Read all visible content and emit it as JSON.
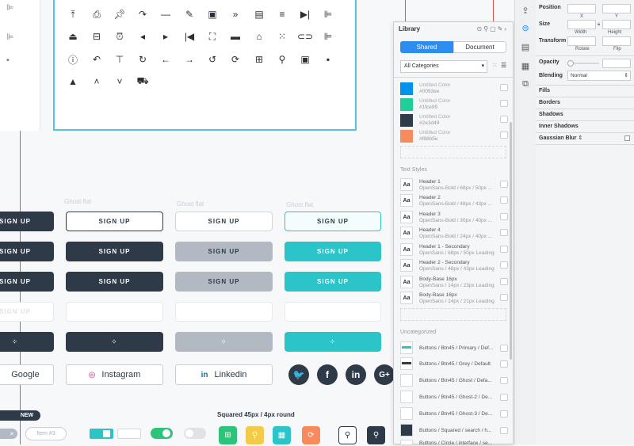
{
  "ghost_label": "Ghost flat",
  "buttons": {
    "sign_up": "SIGN UP"
  },
  "social": {
    "google": "Google",
    "instagram": "Instagram",
    "linkedin": "Linkedin",
    "twitter_icon": "twitter-icon",
    "facebook_icon": "facebook-icon",
    "linkedin_icon": "linkedin-icon",
    "gplus_icon": "google-plus-icon",
    "twitter_glyph": "🐦",
    "facebook_glyph": "f",
    "linkedin_glyph": "in",
    "gplus_glyph": "G+"
  },
  "bottom": {
    "new_badge": "NEW",
    "item_input": "Item #3",
    "squared_title": "Squared 45px / 4px round"
  },
  "library": {
    "title": "Library",
    "tab_shared": "Shared",
    "tab_document": "Document",
    "category": "All Categories",
    "colors": [
      {
        "name": "Untitled Color",
        "hex": "#0093ee"
      },
      {
        "name": "Untitled Color",
        "hex": "#1fce99"
      },
      {
        "name": "Untitled Color",
        "hex": "#2e3d49"
      },
      {
        "name": "Untitled Color",
        "hex": "#f88b5e"
      }
    ],
    "text_styles_label": "Text Styles",
    "text_styles": [
      {
        "name": "Header 1",
        "desc": "OpenSans-Bold / 68px / 50px ..."
      },
      {
        "name": "Header 2",
        "desc": "OpenSans-Bold / 48px / 43px ..."
      },
      {
        "name": "Header 3",
        "desc": "OpenSans-Bold / 30px / 40px ..."
      },
      {
        "name": "Header 4",
        "desc": "OpenSans-Bold / 24px / 40px ..."
      },
      {
        "name": "Header 1 - Secondary",
        "desc": "OpenSans / 68px / 50px Leading"
      },
      {
        "name": "Header 2 - Secondary",
        "desc": "OpenSans / 48px / 43px Leading"
      },
      {
        "name": "Body-Base 16px",
        "desc": "OpenSans / 14px / 23px Leading"
      },
      {
        "name": "Body-Base 16px",
        "desc": "OpenSans / 14px / 21px Leading"
      }
    ],
    "aa": "Aa",
    "uncategorized_label": "Uncategorized",
    "symbols": [
      "Buttons / Btn45 / Primary / Def...",
      "Buttons / Btn45 / Grey / Default",
      "Buttons / Btn45 / Ghost / Defa...",
      "Buttons / Btn45 / Ghost-2 / De...",
      "Buttons / Btn45 / Ghost-3 / De...",
      "Buttons / Squared / search / h...",
      "Buttons / Circle / interface / se..."
    ]
  },
  "inspector": {
    "position": "Position",
    "x": "X",
    "y": "Y",
    "size": "Size",
    "width": "Width",
    "height": "Height",
    "transform": "Transform",
    "rotate": "Rotate",
    "flip": "Flip",
    "opacity": "Opacity",
    "blending": "Blending",
    "blending_value": "Normal",
    "fills": "Fills",
    "borders": "Borders",
    "shadows": "Shadows",
    "inner_shadows": "Inner Shadows",
    "gaussian_blur": "Gaussian Blur"
  },
  "colors": {
    "dark": "#2e3a47",
    "teal": "#2bc4c9",
    "grey": "#b3b9c2",
    "accent_blue": "#56c3e0",
    "guide_red": "#e8544d"
  },
  "icons": {
    "grid_row1": [
      "upload-icon",
      "print-icon",
      "pin-icon",
      "redo-icon",
      "minus-icon",
      "pencil-icon",
      "save-doc-icon",
      "double-chevron-right-icon",
      "sd-card-icon",
      "filter-icon",
      "skip-forward-icon",
      "align-left-icon"
    ],
    "grid_row2": [
      "upload-tray-icon",
      "minus-box-icon",
      "alarm-icon",
      "triangle-left-icon",
      "triangle-right-icon",
      "skip-back-icon",
      "expand-icon",
      "folder-icon",
      "home-icon",
      "grid-icon",
      "link-icon",
      "align-right-icon"
    ],
    "grid_row3": [
      "info-icon",
      "undo-icon",
      "align-top-icon",
      "refresh-icon",
      "arrow-left-icon",
      "arrow-right-icon",
      "rotate-ccw-icon",
      "sync-icon",
      "add-file-icon",
      "map-pin-icon",
      "floppy-icon",
      "briefcase-icon"
    ],
    "grid_row4": [
      "warning-icon",
      "chevron-up-icon",
      "chevron-down-icon",
      "truck-icon"
    ]
  }
}
